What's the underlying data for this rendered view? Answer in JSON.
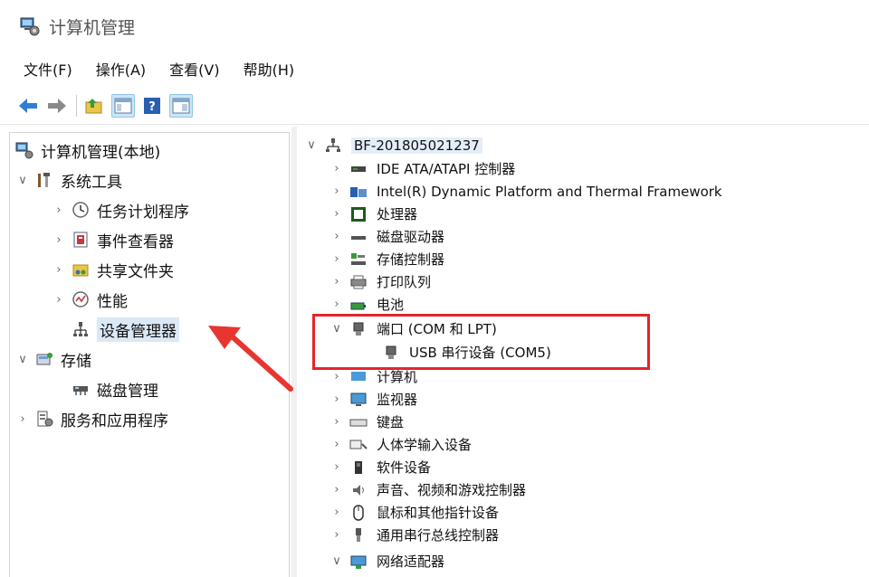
{
  "window": {
    "title": "计算机管理"
  },
  "menu": [
    "文件(F)",
    "操作(A)",
    "查看(V)",
    "帮助(H)"
  ],
  "left_tree": [
    {
      "label": "计算机管理(本地)",
      "icon": "computer-management-icon",
      "chev": ""
    },
    {
      "label": "系统工具",
      "icon": "system-tools-icon",
      "chev": "∨"
    },
    {
      "label": "任务计划程序",
      "icon": "clock-icon",
      "chev": "›"
    },
    {
      "label": "事件查看器",
      "icon": "event-viewer-icon",
      "chev": "›"
    },
    {
      "label": "共享文件夹",
      "icon": "shared-folder-icon",
      "chev": "›"
    },
    {
      "label": "性能",
      "icon": "performance-icon",
      "chev": "›"
    },
    {
      "label": "设备管理器",
      "icon": "device-manager-icon",
      "chev": ""
    },
    {
      "label": "存储",
      "icon": "storage-icon",
      "chev": "∨"
    },
    {
      "label": "磁盘管理",
      "icon": "disk-management-icon",
      "chev": ""
    },
    {
      "label": "服务和应用程序",
      "icon": "services-icon",
      "chev": "›"
    }
  ],
  "right_tree": [
    {
      "label": "BF-201805021237",
      "icon": "computer-icon",
      "chev": "∨"
    },
    {
      "label": "IDE ATA/ATAPI 控制器",
      "icon": "ide-controller-icon",
      "chev": "›"
    },
    {
      "label": "Intel(R) Dynamic Platform and Thermal Framework",
      "icon": "platform-icon",
      "chev": "›"
    },
    {
      "label": "处理器",
      "icon": "processor-icon",
      "chev": "›"
    },
    {
      "label": "磁盘驱动器",
      "icon": "disk-drive-icon",
      "chev": "›"
    },
    {
      "label": "存储控制器",
      "icon": "storage-controller-icon",
      "chev": "›"
    },
    {
      "label": "打印队列",
      "icon": "print-queue-icon",
      "chev": "›"
    },
    {
      "label": "电池",
      "icon": "battery-icon",
      "chev": "›"
    },
    {
      "label": "端口 (COM 和 LPT)",
      "icon": "port-icon",
      "chev": "∨"
    },
    {
      "label": "USB 串行设备 (COM5)",
      "icon": "port-icon",
      "chev": ""
    },
    {
      "label": "计算机",
      "icon": "computer-category-icon",
      "chev": "›"
    },
    {
      "label": "监视器",
      "icon": "monitor-icon",
      "chev": "›"
    },
    {
      "label": "键盘",
      "icon": "keyboard-icon",
      "chev": "›"
    },
    {
      "label": "人体学输入设备",
      "icon": "hid-icon",
      "chev": "›"
    },
    {
      "label": "软件设备",
      "icon": "software-device-icon",
      "chev": "›"
    },
    {
      "label": "声音、视频和游戏控制器",
      "icon": "sound-icon",
      "chev": "›"
    },
    {
      "label": "鼠标和其他指针设备",
      "icon": "mouse-icon",
      "chev": "›"
    },
    {
      "label": "通用串行总线控制器",
      "icon": "usb-icon",
      "chev": "›"
    },
    {
      "label": "网络适配器",
      "icon": "network-adapter-icon",
      "chev": "∨"
    }
  ],
  "colors": {
    "highlight_box": "#e3252b",
    "arrow": "#e8352f",
    "accent": "#1e78c8"
  }
}
